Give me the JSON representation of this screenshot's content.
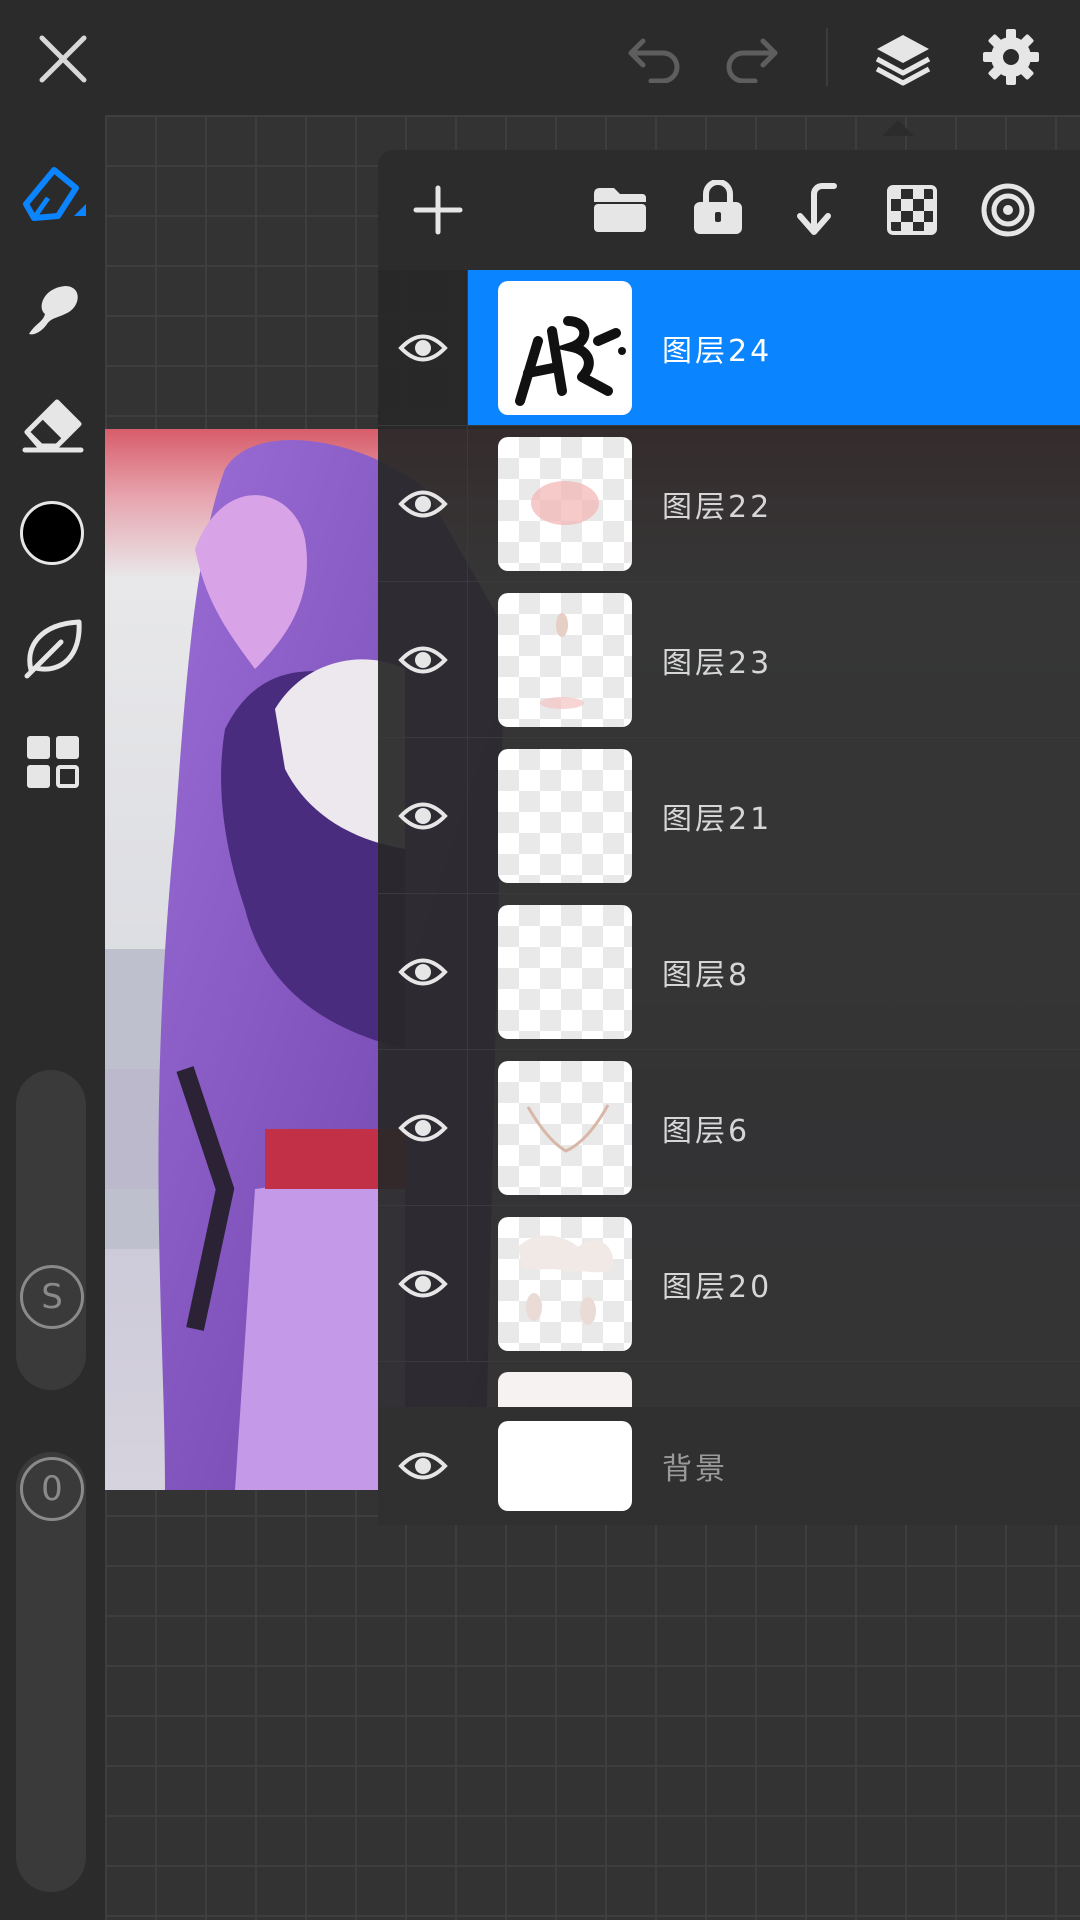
{
  "colors": {
    "accent": "#0a84ff",
    "current_color": "#000000"
  },
  "topbar": {
    "icons": [
      "close-icon",
      "undo-icon",
      "redo-icon",
      "layers-icon",
      "settings-icon"
    ]
  },
  "toolbar": {
    "icons": [
      "brush-icon",
      "smudge-icon",
      "eraser-icon",
      "color-swatch",
      "leaf-icon",
      "grid-icon"
    ],
    "size_label": "S",
    "opacity_label": "0"
  },
  "layers_toolbar": {
    "icons": [
      "add-icon",
      "folder-icon",
      "lock-icon",
      "merge-down-icon",
      "transparency-icon",
      "target-icon"
    ]
  },
  "layers": [
    {
      "name": "图层24",
      "selected": true
    },
    {
      "name": "图层22",
      "selected": false
    },
    {
      "name": "图层23",
      "selected": false
    },
    {
      "name": "图层21",
      "selected": false
    },
    {
      "name": "图层8",
      "selected": false
    },
    {
      "name": "图层6",
      "selected": false
    },
    {
      "name": "图层20",
      "selected": false
    }
  ],
  "background_layer": {
    "name": "背景"
  }
}
